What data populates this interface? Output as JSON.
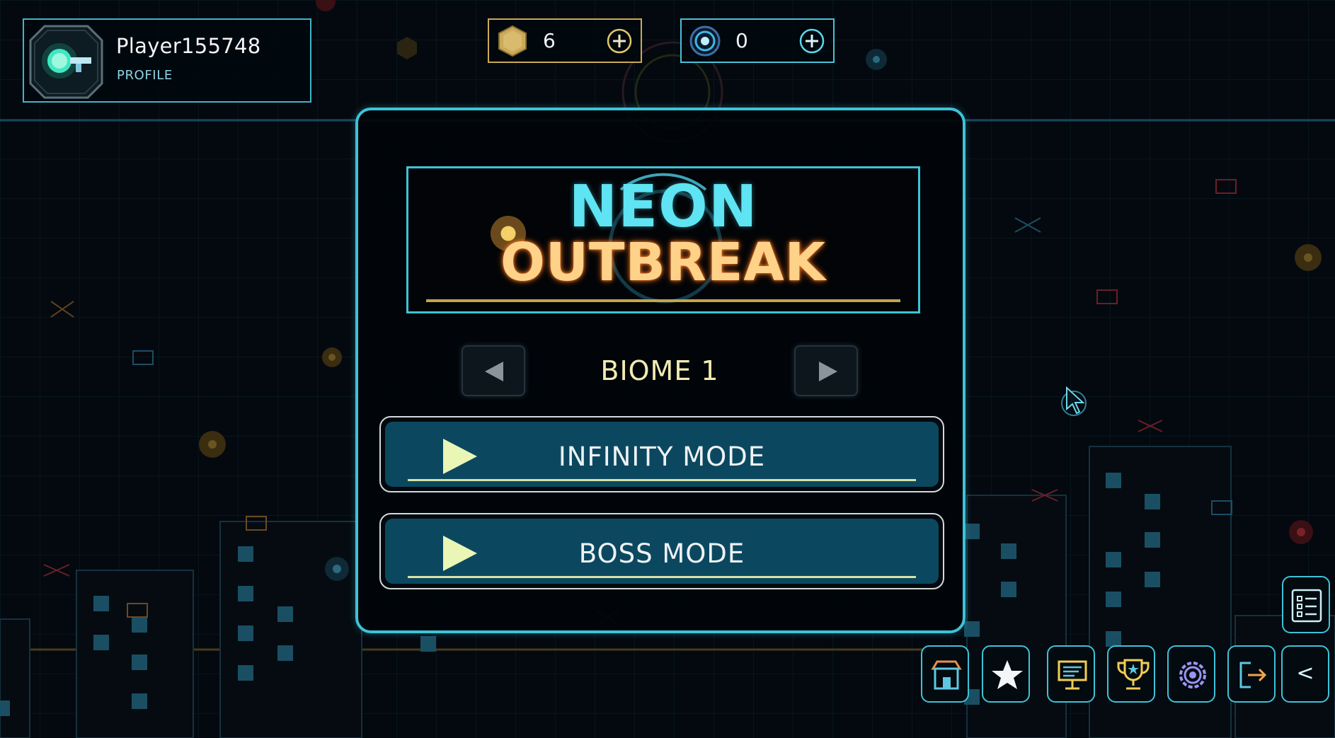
{
  "profile": {
    "name": "Player155748",
    "label": "PROFILE"
  },
  "currencies": {
    "gold": {
      "value": "6",
      "color": "#c8ab55"
    },
    "gems": {
      "value": "0",
      "color": "#47c2d6"
    }
  },
  "title": {
    "line1": "NEON",
    "line2": "OUTBREAK"
  },
  "biome": {
    "label": "BIOME 1"
  },
  "modes": {
    "infinity": "INFINITY MODE",
    "boss": "BOSS MODE"
  },
  "toolbar": {
    "collapse_label": "<",
    "icons": [
      "shop-icon",
      "star-icon",
      "billboard-icon",
      "trophy-icon",
      "settings-icon",
      "exit-icon",
      "collapse-icon",
      "quest-list-icon"
    ]
  },
  "colors": {
    "accent": "#3dc3d8",
    "gold": "#c2a64b",
    "button": "#0b4860",
    "title_cyan": "#5ee4f2",
    "title_orange": "#ffd28a"
  }
}
